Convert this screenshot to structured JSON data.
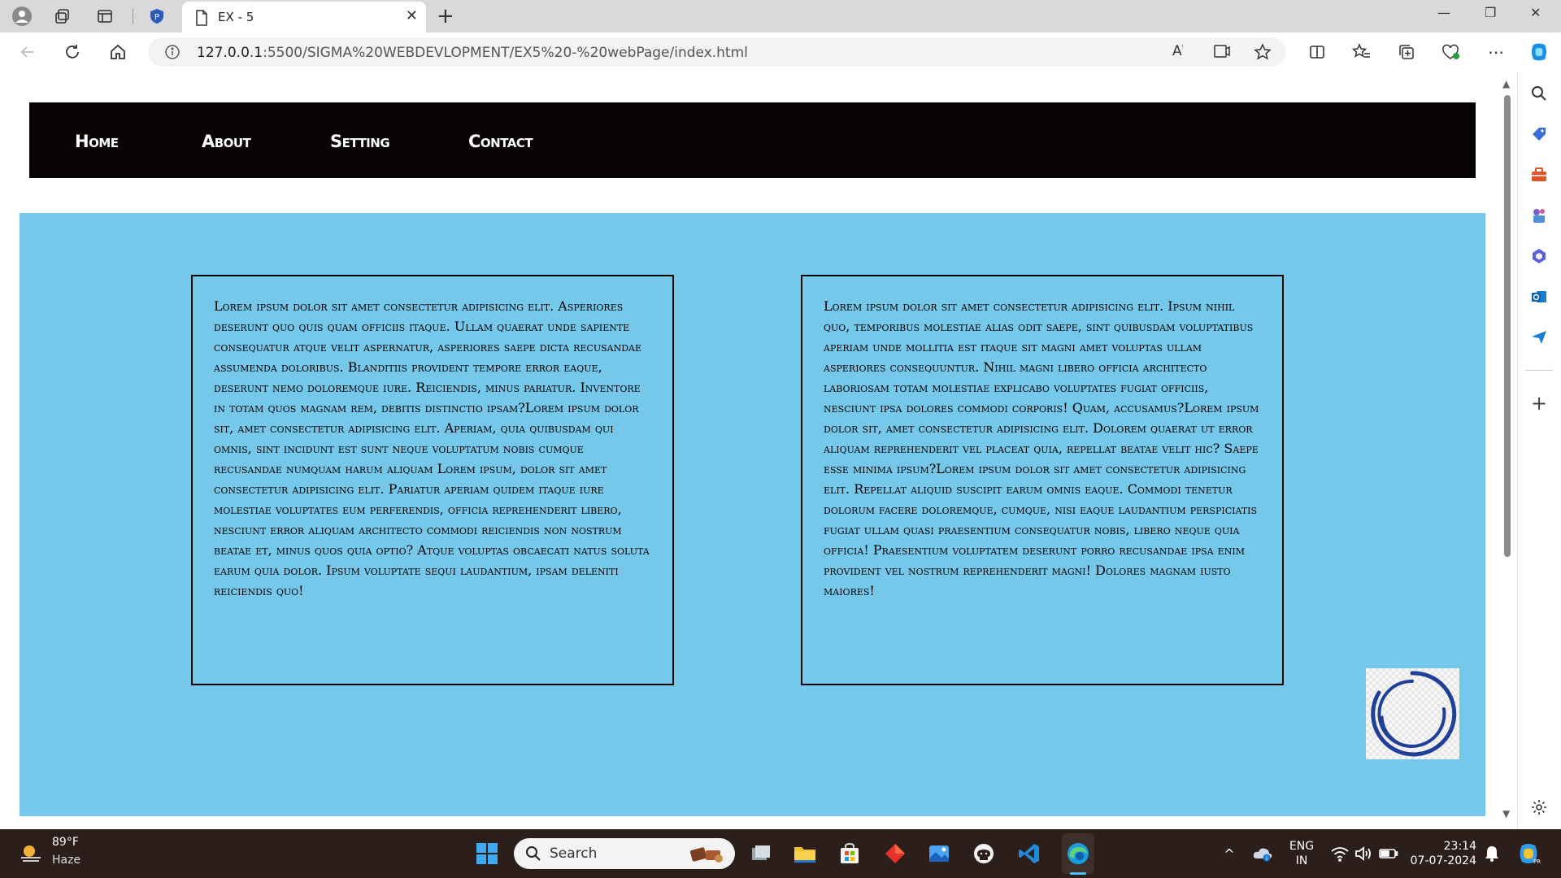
{
  "browser": {
    "tab_title": "EX - 5",
    "url_host": "127.0.0.1",
    "url_rest": ":5500/SIGMA%20WEBDEVLOPMENT/EX5%20-%20webPage/index.html"
  },
  "site": {
    "nav": [
      "Home",
      "About",
      "Setting",
      "Contact"
    ],
    "card1_text": "Lorem ipsum dolor sit amet consectetur adipisicing elit. Asperiores deserunt quo quis quam officiis itaque. Ullam quaerat unde sapiente consequatur atque velit aspernatur, asperiores saepe dicta recusandae assumenda doloribus. Blanditiis provident tempore error eaque, deserunt nemo doloremque iure. Reiciendis, minus pariatur. Inventore in totam quos magnam rem, debitis distinctio ipsam?Lorem ipsum dolor sit, amet consectetur adipisicing elit. Aperiam, quia quibusdam qui omnis, sint incidunt est sunt neque voluptatum nobis cumque recusandae numquam harum aliquam Lorem ipsum, dolor sit amet consectetur adipisicing elit. Pariatur aperiam quidem itaque iure molestiae voluptates eum perferendis, officia reprehenderit libero, nesciunt error aliquam architecto commodi reiciendis non nostrum beatae et, minus quos quia optio? Atque voluptas obcaecati natus soluta earum quia dolor. Ipsum voluptate sequi laudantium, ipsam deleniti reiciendis quo!",
    "card2_text": "Lorem ipsum dolor sit amet consectetur adipisicing elit. Ipsum nihil quo, temporibus molestiae alias odit saepe, sint quibusdam voluptatibus aperiam unde mollitia est itaque sit magni amet voluptas ullam asperiores consequuntur. Nihil magni libero officia architecto laboriosam totam molestiae explicabo voluptates fugiat officiis, nesciunt ipsa dolores commodi corporis! Quam, accusamus?Lorem ipsum dolor sit, amet consectetur adipisicing elit. Dolorem quaerat ut error aliquam reprehenderit vel placeat quia, repellat beatae velit hic? Saepe esse minima ipsum?Lorem ipsum dolor sit amet consectetur adipisicing elit. Repellat aliquid suscipit earum omnis eaque. Commodi tenetur dolorum facere doloremque, cumque, nisi eaque laudantium perspiciatis fugiat ullam quasi praesentium consequatur nobis, libero neque quia officia! Praesentium voluptatem deserunt porro recusandae ipsa enim provident vel nostrum reprehenderit magni! Dolores magnam iusto maiores!"
  },
  "taskbar": {
    "weather_temp": "89°F",
    "weather_desc": "Haze",
    "search_placeholder": "Search",
    "lang_line1": "ENG",
    "lang_line2": "IN",
    "time": "23:14",
    "date": "07-07-2024"
  },
  "colors": {
    "nav_bg": "#070203",
    "hero_bg": "#76c8ea",
    "spinner": "#1f3f99"
  }
}
